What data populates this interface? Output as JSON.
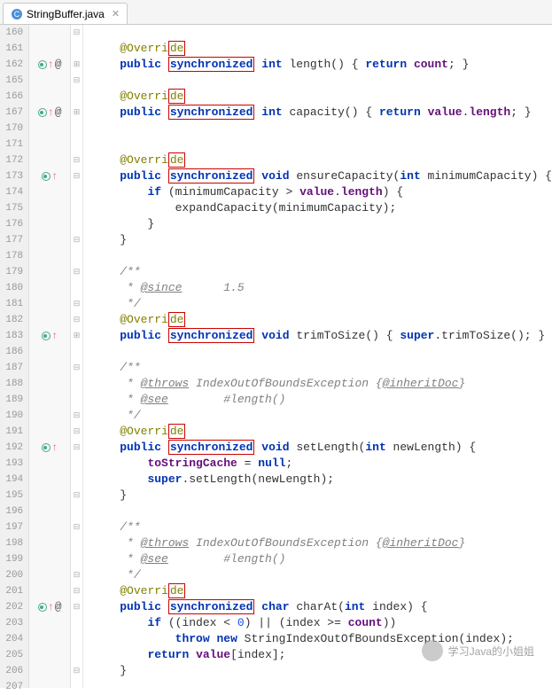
{
  "tab": {
    "filename": "StringBuffer.java",
    "icon": "java-class-icon"
  },
  "watermark": {
    "text": "学习Java的小姐姐"
  },
  "gutter_lines": [
    "160",
    "161",
    "162",
    "165",
    "166",
    "167",
    "170",
    "171",
    "172",
    "173",
    "174",
    "175",
    "176",
    "177",
    "178",
    "179",
    "180",
    "181",
    "182",
    "183",
    "186",
    "187",
    "188",
    "189",
    "190",
    "191",
    "192",
    "193",
    "194",
    "195",
    "196",
    "197",
    "198",
    "199",
    "200",
    "201",
    "202",
    "203",
    "204",
    "205",
    "206",
    "207"
  ],
  "marks": {
    "162": [
      "o",
      "up",
      "at"
    ],
    "167": [
      "o",
      "up",
      "at"
    ],
    "173": [
      "o",
      "up"
    ],
    "183": [
      "o",
      "up"
    ],
    "192": [
      "o",
      "up"
    ],
    "202": [
      "o",
      "up",
      "at"
    ]
  },
  "fold": {
    "160": "⊟",
    "162": "⊞",
    "165": "⊟",
    "167": "⊞",
    "172": "⊟",
    "173": "⊟",
    "177": "⊟",
    "179": "⊟",
    "181": "⊟",
    "182": "⊟",
    "183": "⊞",
    "187": "⊟",
    "190": "⊟",
    "191": "⊟",
    "192": "⊟",
    "195": "⊟",
    "197": "⊟",
    "200": "⊟",
    "201": "⊟",
    "202": "⊟",
    "206": "⊟"
  },
  "code": {
    "l161": {
      "ann": "@Override"
    },
    "l162": {
      "kw1": "public",
      "sync": "synchronized",
      "type": "int",
      "name": " length() ",
      "br1": "{",
      "ret": " return ",
      "field": "count",
      "end": "; }"
    },
    "l166": {
      "ann": "@Override"
    },
    "l167": {
      "kw1": "public",
      "sync": "synchronized",
      "type": "int",
      "name": " capacity() ",
      "br1": "{",
      "ret": " return ",
      "field1": "value",
      "dot": ".",
      "field2": "length",
      "end": "; }"
    },
    "l172": {
      "ann": "@Override"
    },
    "l173": {
      "kw1": "public",
      "sync": "synchronized",
      "type": "void",
      "name": " ensureCapacity(",
      "ptype": "int",
      "pname": " minimumCapacity) {"
    },
    "l174": {
      "indent": "        ",
      "kw": "if",
      "txt1": " (minimumCapacity > ",
      "f1": "value",
      "d": ".",
      "f2": "length",
      "txt2": ") {"
    },
    "l175": {
      "txt": "            expandCapacity(minimumCapacity);"
    },
    "l176": {
      "txt": "        }"
    },
    "l177": {
      "txt": "    }"
    },
    "l179": {
      "txt": "    /**"
    },
    "l180": {
      "pre": "     * ",
      "tag": "@since",
      "rest": "      1.5"
    },
    "l181": {
      "txt": "     */"
    },
    "l182": {
      "ann": "@Override"
    },
    "l183": {
      "kw1": "public",
      "sync": "synchronized",
      "type": "void",
      "name": " trimToSize() ",
      "br1": "{",
      "sup": " super",
      "call": ".trimToSize(); ",
      "br2": "}"
    },
    "l187": {
      "txt": "    /**"
    },
    "l188": {
      "pre": "     * ",
      "tag": "@throws",
      "mid": " IndexOutOfBoundsException {",
      "tag2": "@inheritDoc",
      "end": "}"
    },
    "l189": {
      "pre": "     * ",
      "tag": "@see",
      "rest": "        #length()"
    },
    "l190": {
      "txt": "     */"
    },
    "l191": {
      "ann": "@Override"
    },
    "l192": {
      "kw1": "public",
      "sync": "synchronized",
      "type": "void",
      "name": " setLength(",
      "ptype": "int",
      "pname": " newLength) {"
    },
    "l193": {
      "indent": "        ",
      "f1": "toStringCache",
      "eq": " = ",
      "kw": "null",
      "end": ";"
    },
    "l194": {
      "indent": "        ",
      "sup": "super",
      "call": ".setLength(newLength);"
    },
    "l195": {
      "txt": "    }"
    },
    "l197": {
      "txt": "    /**"
    },
    "l198": {
      "pre": "     * ",
      "tag": "@throws",
      "mid": " IndexOutOfBoundsException {",
      "tag2": "@inheritDoc",
      "end": "}"
    },
    "l199": {
      "pre": "     * ",
      "tag": "@see",
      "rest": "        #length()"
    },
    "l200": {
      "txt": "     */"
    },
    "l201": {
      "ann": "@Override"
    },
    "l202": {
      "kw1": "public",
      "sync": "synchronized",
      "type": "char",
      "name": " charAt(",
      "ptype": "int",
      "pname": " index) {"
    },
    "l203": {
      "indent": "        ",
      "kw": "if",
      "t1": " ((index < ",
      "n1": "0",
      "t2": ") || (index >= ",
      "f1": "count",
      "t3": "))"
    },
    "l204": {
      "indent": "            ",
      "kw1": "throw",
      "sp": " ",
      "kw2": "new",
      "call": " StringIndexOutOfBoundsException(index);"
    },
    "l205": {
      "indent": "        ",
      "kw": "return",
      "sp": " ",
      "f1": "value",
      "rest": "[index];"
    },
    "l206": {
      "txt": "    }"
    }
  }
}
